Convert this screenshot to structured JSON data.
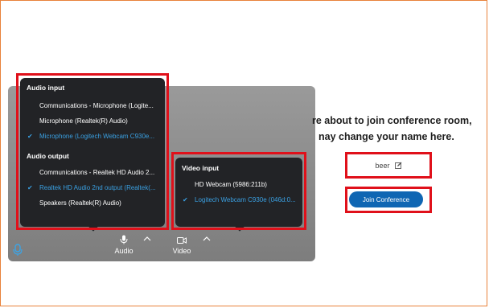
{
  "audio_menu": {
    "input_heading": "Audio input",
    "input_items": [
      {
        "label": "Communications - Microphone (Logite...",
        "selected": false
      },
      {
        "label": "Microphone (Realtek(R) Audio)",
        "selected": false
      },
      {
        "label": "Microphone (Logitech Webcam C930e...",
        "selected": true
      }
    ],
    "output_heading": "Audio output",
    "output_items": [
      {
        "label": "Communications - Realtek HD Audio 2...",
        "selected": false
      },
      {
        "label": "Realtek HD Audio 2nd output (Realtek(...",
        "selected": true
      },
      {
        "label": "Speakers (Realtek(R) Audio)",
        "selected": false
      }
    ]
  },
  "video_menu": {
    "heading": "Video input",
    "items": [
      {
        "label": "HD Webcam (5986:211b)",
        "selected": false
      },
      {
        "label": "Logitech Webcam C930e (046d:0...",
        "selected": true
      }
    ]
  },
  "controls": {
    "audio_label": "Audio",
    "video_label": "Video"
  },
  "join_panel": {
    "line1": "re about to join conference room,",
    "line2": "nay change your name here.",
    "name_value": "beer",
    "join_button": "Join Conference"
  },
  "colors": {
    "accent": "#3aa0e2",
    "button": "#0f66b3",
    "highlight": "#e0101a",
    "frame": "#e8823a"
  }
}
